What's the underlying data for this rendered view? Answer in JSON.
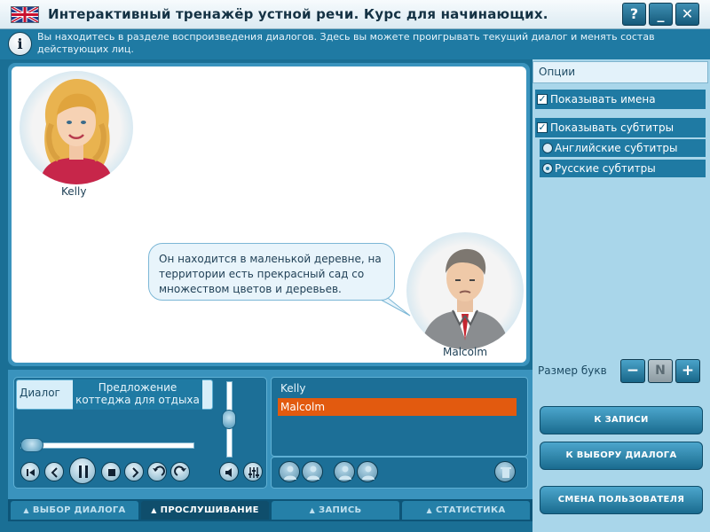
{
  "window": {
    "title": "Интерактивный тренажёр устной речи. Курс для начинающих.",
    "help_label": "?",
    "minimize_label": "_",
    "close_label": "✕"
  },
  "info": {
    "text": "Вы находитесь в разделе воспроизведения диалогов. Здесь вы можете проигрывать текущий диалог и менять состав действующих лиц."
  },
  "stage": {
    "characters": [
      {
        "name": "Kelly"
      },
      {
        "name": "Malcolm"
      }
    ],
    "speech_bubble": "Он находится в маленькой деревне, на территории есть прекрасный сад со множеством цветов и деревьев."
  },
  "options": {
    "header": "Опции",
    "show_names": {
      "label": "Показывать имена",
      "checked": true
    },
    "show_subtitles": {
      "label": "Показывать субтитры",
      "checked": true
    },
    "subtitle_languages": [
      {
        "label": "Английские субтитры",
        "selected": false
      },
      {
        "label": "Русские субтитры",
        "selected": true
      }
    ],
    "font_size_label": "Размер букв",
    "font_size_buttons": {
      "minus": "−",
      "n": "N",
      "plus": "+"
    },
    "actions": [
      {
        "label": "К ЗАПИСИ"
      },
      {
        "label": "К ВЫБОРУ ДИАЛОГА"
      },
      {
        "label": "СМЕНА ПОЛЬЗОВАТЕЛЯ"
      }
    ]
  },
  "player": {
    "dialog_label": "Диалог",
    "dialog_title": "Предложение коттеджа для отдыха",
    "progress": 0.0,
    "volume": 0.5
  },
  "roles": {
    "items": [
      {
        "name": "Kelly",
        "selected": false
      },
      {
        "name": "Malcolm",
        "selected": true
      }
    ]
  },
  "tabs": [
    {
      "label": "ВЫБОР ДИАЛОГА",
      "active": false
    },
    {
      "label": "ПРОСЛУШИВАНИЕ",
      "active": true
    },
    {
      "label": "ЗАПИСЬ",
      "active": false
    },
    {
      "label": "СТАТИСТИКА",
      "active": false
    }
  ],
  "colors": {
    "accent": "#1f7aa3",
    "selected_role": "#e25a0f",
    "panel": "#a9d6ea"
  }
}
